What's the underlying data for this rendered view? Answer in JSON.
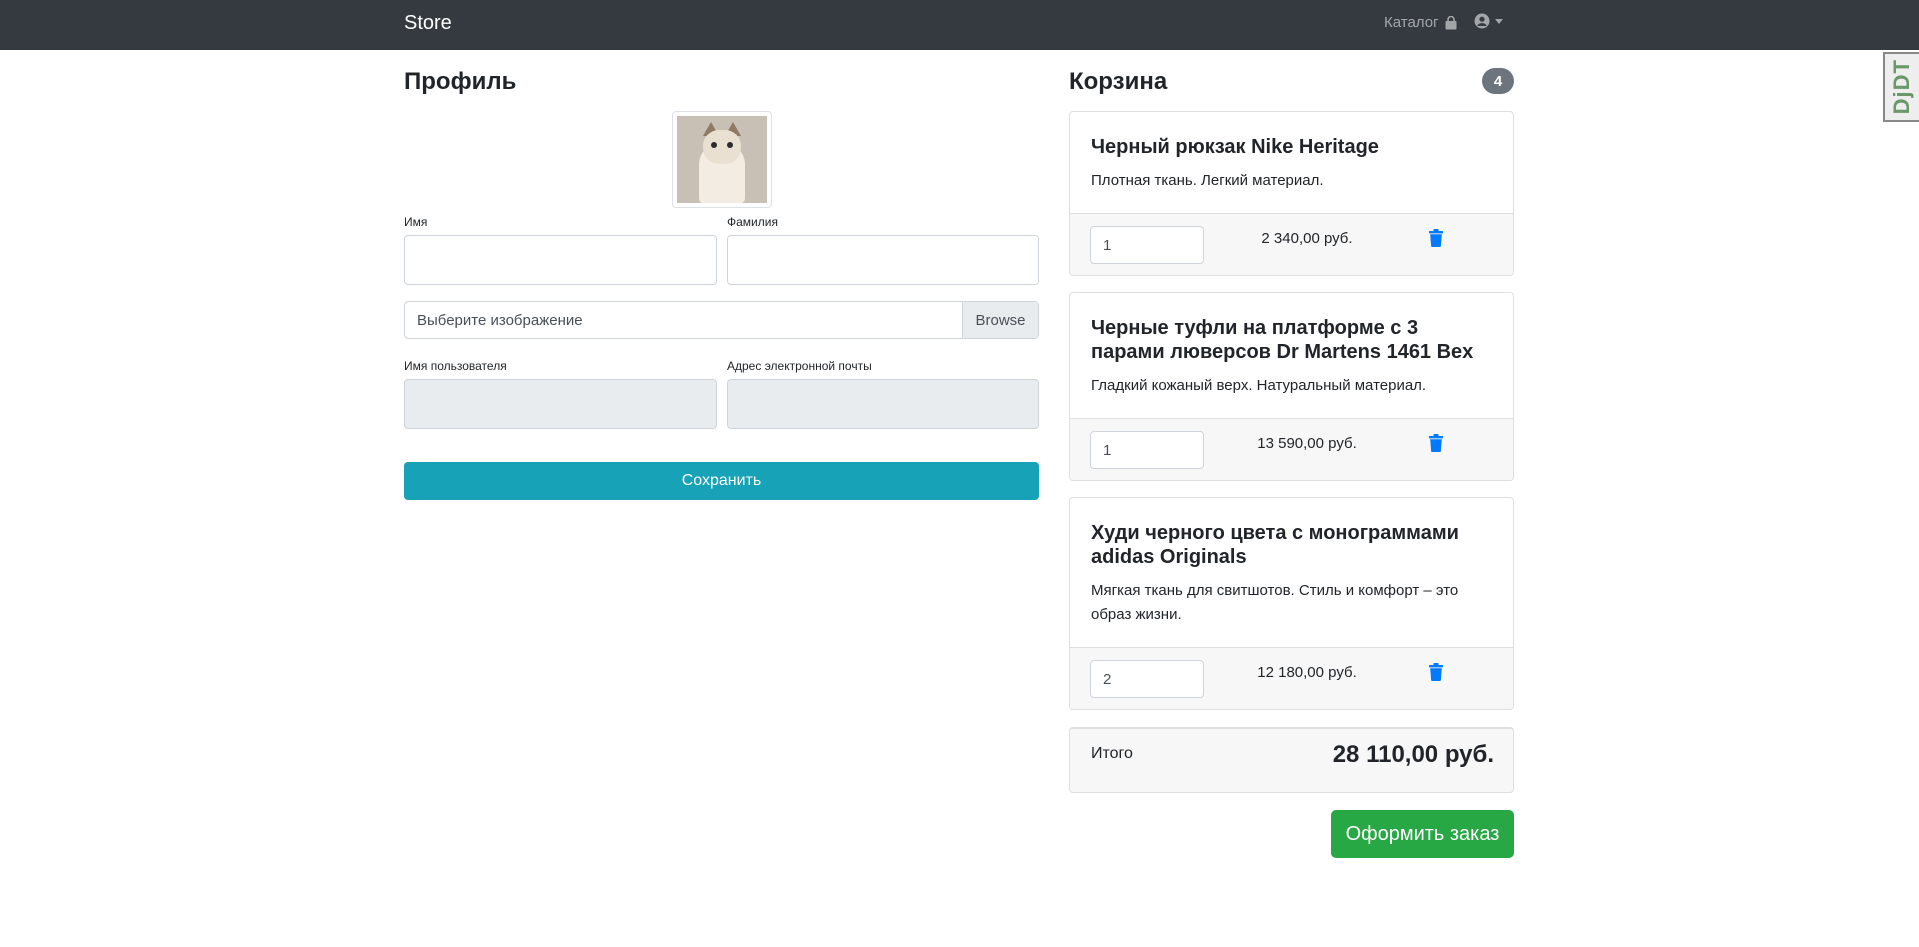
{
  "navbar": {
    "brand": "Store",
    "catalog_label": "Каталог",
    "catalog_icon": "shopping-bag-icon",
    "user_icon": "user-circle-icon"
  },
  "profile": {
    "title": "Профиль",
    "first_name_label": "Имя",
    "first_name_value": "",
    "last_name_label": "Фамилия",
    "last_name_value": "",
    "file_placeholder": "Выберите изображение",
    "browse_label": "Browse",
    "username_label": "Имя пользователя",
    "username_value": "",
    "email_label": "Адрес электронной почты",
    "email_value": "",
    "save_label": "Сохранить"
  },
  "cart": {
    "title": "Корзина",
    "count": "4",
    "items": [
      {
        "name": "Черный рюкзак Nike Heritage",
        "description": "Плотная ткань. Легкий материал.",
        "quantity": "1",
        "price": "2 340,00 руб."
      },
      {
        "name": "Черные туфли на платформе с 3 парами люверсов Dr Martens 1461 Bex",
        "description": "Гладкий кожаный верх. Натуральный материал.",
        "quantity": "1",
        "price": "13 590,00 руб."
      },
      {
        "name": "Худи черного цвета с монограммами adidas Originals",
        "description": "Мягкая ткань для свитшотов. Стиль и комфорт – это образ жизни.",
        "quantity": "2",
        "price": "12 180,00 руб."
      }
    ],
    "total_label": "Итого",
    "total_value": "28 110,00 руб.",
    "order_label": "Оформить заказ"
  },
  "debug_toolbar": {
    "label": "DjDT"
  },
  "colors": {
    "navbar": "#343a40",
    "save_button": "#17a2b8",
    "order_button": "#28a745",
    "trash_icon": "#007bff",
    "badge": "#6c757d"
  }
}
